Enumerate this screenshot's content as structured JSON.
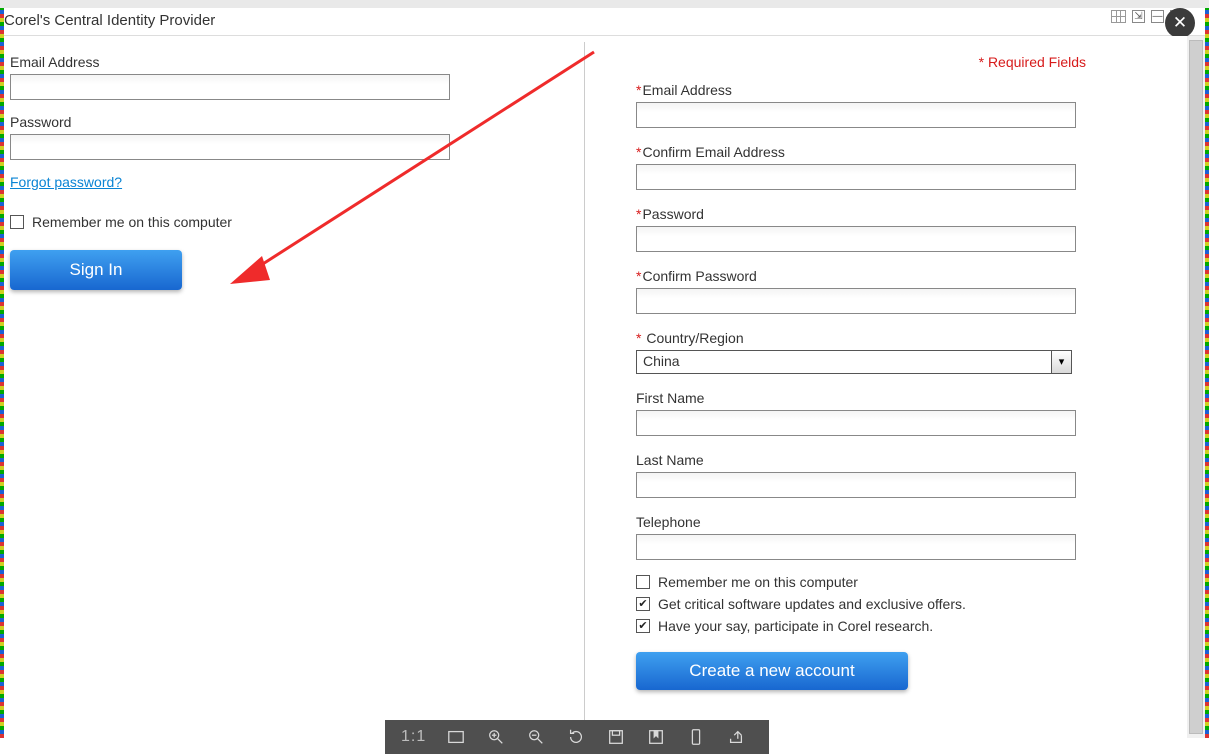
{
  "window": {
    "title": "Corel's Central Identity Provider"
  },
  "signin": {
    "email_label": "Email Address",
    "password_label": "Password",
    "forgot_label": "Forgot password?",
    "remember_label": "Remember me on this computer",
    "button_label": "Sign In"
  },
  "register": {
    "required_note": "* Required Fields",
    "email_label": "Email Address",
    "confirm_email_label": "Confirm Email Address",
    "password_label": "Password",
    "confirm_password_label": "Confirm Password",
    "country_label": " Country/Region",
    "country_value": "China",
    "first_name_label": "First Name",
    "last_name_label": "Last Name",
    "telephone_label": "Telephone",
    "remember_label": "Remember me on this computer",
    "updates_label": "Get critical software updates and exclusive offers.",
    "research_label": "Have your say, participate in Corel research.",
    "button_label": "Create a new account"
  },
  "bottom_bar": {
    "ratio": "1:1"
  }
}
